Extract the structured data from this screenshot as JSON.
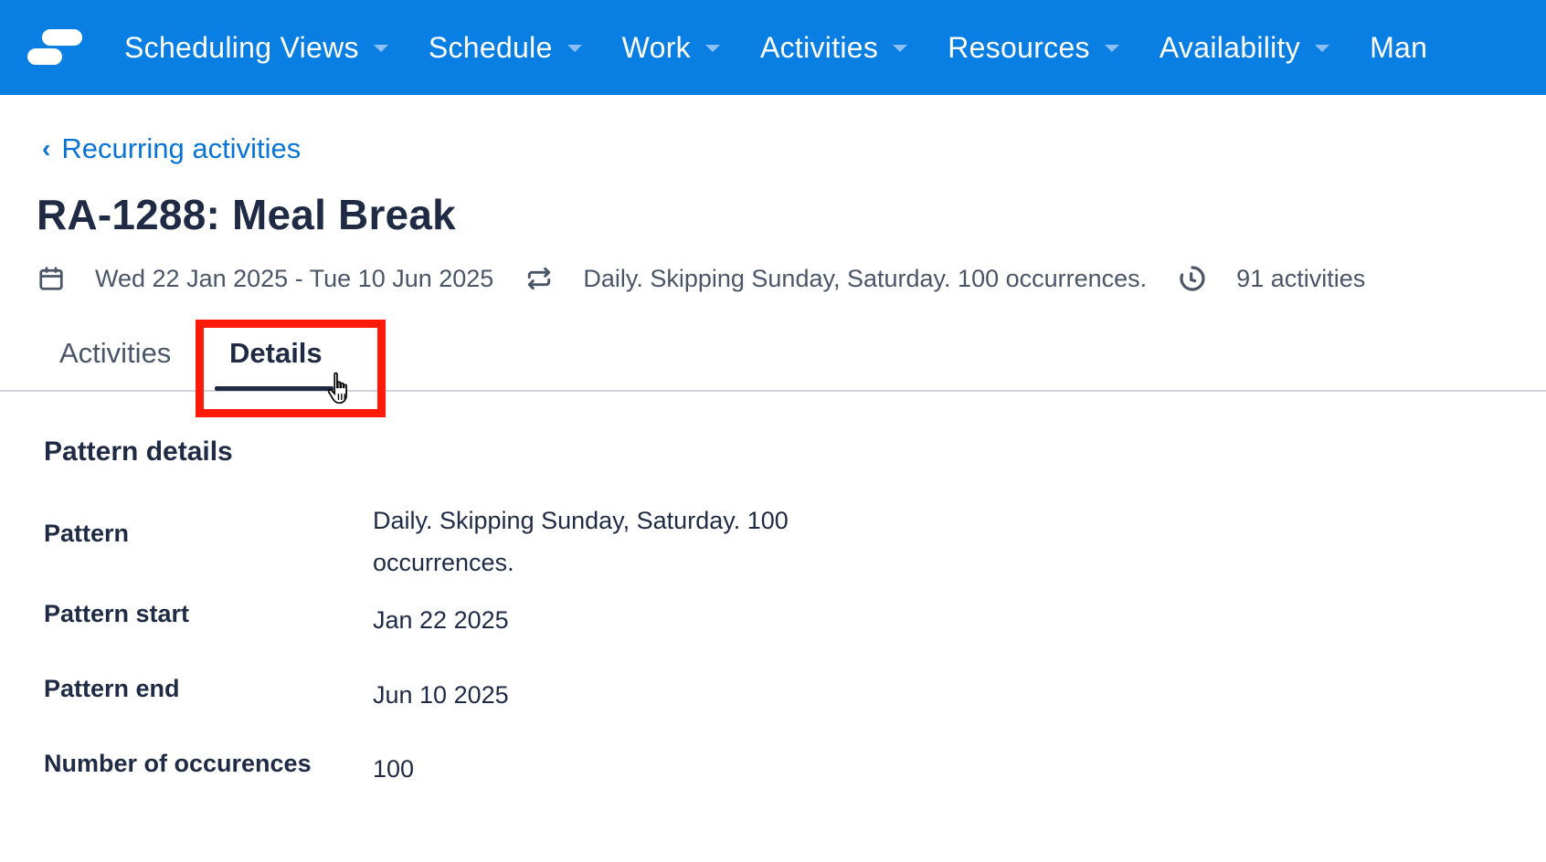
{
  "nav": {
    "items": [
      {
        "label": "Scheduling Views"
      },
      {
        "label": "Schedule"
      },
      {
        "label": "Work"
      },
      {
        "label": "Activities"
      },
      {
        "label": "Resources"
      },
      {
        "label": "Availability"
      },
      {
        "label": "Man"
      }
    ]
  },
  "breadcrumb": {
    "back_label": "Recurring activities"
  },
  "header": {
    "title": "RA-1288: Meal Break",
    "date_range": "Wed 22 Jan 2025 - Tue 10 Jun 2025",
    "recurrence": "Daily. Skipping Sunday, Saturday. 100 occurrences.",
    "activity_count": "91 activities"
  },
  "tabs": [
    {
      "label": "Activities",
      "active": false
    },
    {
      "label": "Details",
      "active": true
    }
  ],
  "details": {
    "section_title": "Pattern details",
    "fields": [
      {
        "label": "Pattern",
        "value": "Daily. Skipping Sunday, Saturday. 100 occurrences."
      },
      {
        "label": "Pattern start",
        "value": "Jan 22 2025"
      },
      {
        "label": "Pattern end",
        "value": "Jun 10 2025"
      },
      {
        "label": "Number of occurences",
        "value": "100"
      }
    ]
  },
  "colors": {
    "nav_background": "#0a7fe3",
    "link": "#0a74d6",
    "text_primary": "#1f2a44",
    "highlight": "#ff1a0a"
  }
}
